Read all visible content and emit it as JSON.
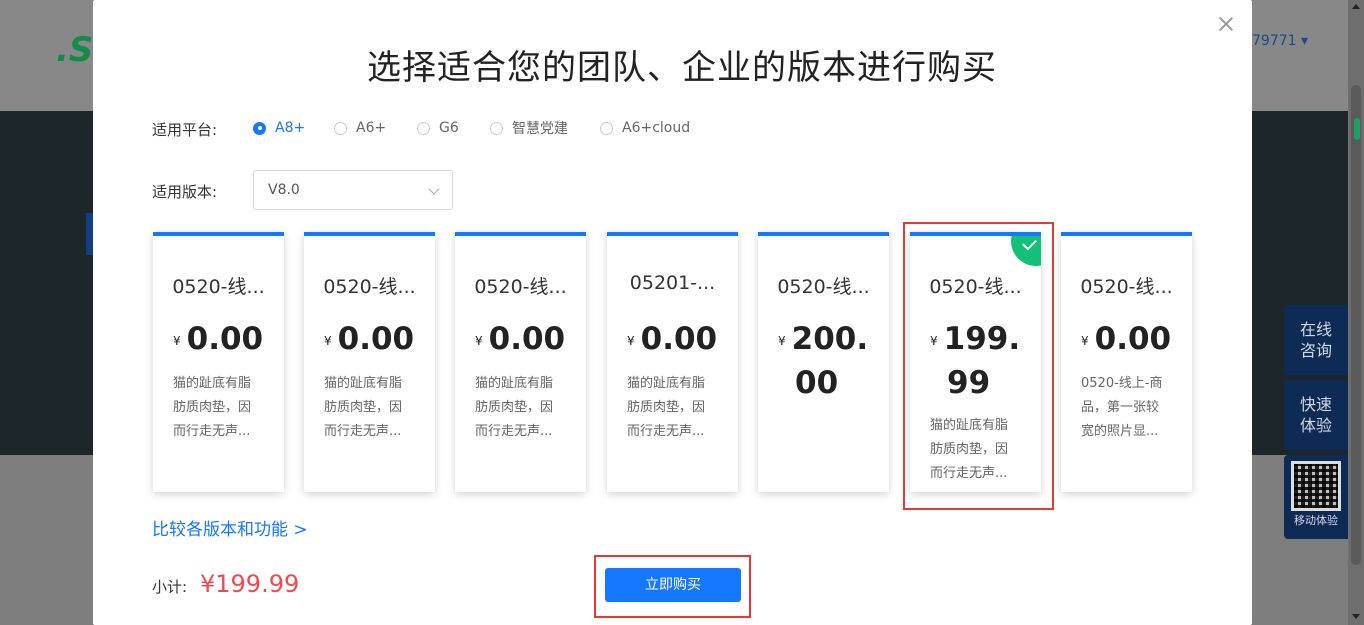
{
  "background": {
    "logo_text": ".S",
    "phone_fragment": "79771 ▾"
  },
  "modal": {
    "title": "选择适合您的团队、企业的版本进行购买",
    "platform_label": "适用平台:",
    "platforms": [
      {
        "label": "A8+",
        "checked": true
      },
      {
        "label": "A6+",
        "checked": false
      },
      {
        "label": "G6",
        "checked": false
      },
      {
        "label": "智慧党建",
        "checked": false
      },
      {
        "label": "A6+cloud",
        "checked": false
      }
    ],
    "version_label": "适用版本:",
    "version_value": "V8.0",
    "products": [
      {
        "name": "0520-线...",
        "currency": "¥",
        "price_line1": "0.00",
        "price_line2": "",
        "desc": [
          "猫的趾底有脂",
          "肪质肉垫，因",
          "而行走无声..."
        ],
        "selected": false
      },
      {
        "name": "0520-线...",
        "currency": "¥",
        "price_line1": "0.00",
        "price_line2": "",
        "desc": [
          "猫的趾底有脂",
          "肪质肉垫，因",
          "而行走无声..."
        ],
        "selected": false
      },
      {
        "name": "0520-线...",
        "currency": "¥",
        "price_line1": "0.00",
        "price_line2": "",
        "desc": [
          "猫的趾底有脂",
          "肪质肉垫，因",
          "而行走无声..."
        ],
        "selected": false
      },
      {
        "name": "05201-...",
        "currency": "¥",
        "price_line1": "0.00",
        "price_line2": "",
        "desc": [
          "猫的趾底有脂",
          "肪质肉垫，因",
          "而行走无声..."
        ],
        "selected": false
      },
      {
        "name": "0520-线...",
        "currency": "¥",
        "price_line1": "200.",
        "price_line2": "00",
        "desc": [
          "",
          "",
          ""
        ],
        "selected": false
      },
      {
        "name": "0520-线...",
        "currency": "¥",
        "price_line1": "199.",
        "price_line2": "99",
        "desc": [
          "猫的趾底有脂",
          "肪质肉垫，因",
          "而行走无声..."
        ],
        "selected": true
      },
      {
        "name": "0520-线...",
        "currency": "¥",
        "price_line1": "0.00",
        "price_line2": "",
        "desc": [
          "0520-线上-商",
          "品，第一张较",
          "宽的照片显..."
        ],
        "selected": false
      }
    ],
    "compare_link": "比较各版本和功能 >",
    "subtotal_label": "小计:",
    "subtotal_value": "¥199.99",
    "buy_button": "立即购买"
  },
  "side": {
    "consult": [
      "在线",
      "咨询"
    ],
    "trial": [
      "快速",
      "体验"
    ],
    "mobile": "移动体验"
  },
  "colors": {
    "accent": "#1677ff",
    "price_red": "#f5474f",
    "check_green": "#13c07a",
    "highlight_red": "#e53935"
  }
}
